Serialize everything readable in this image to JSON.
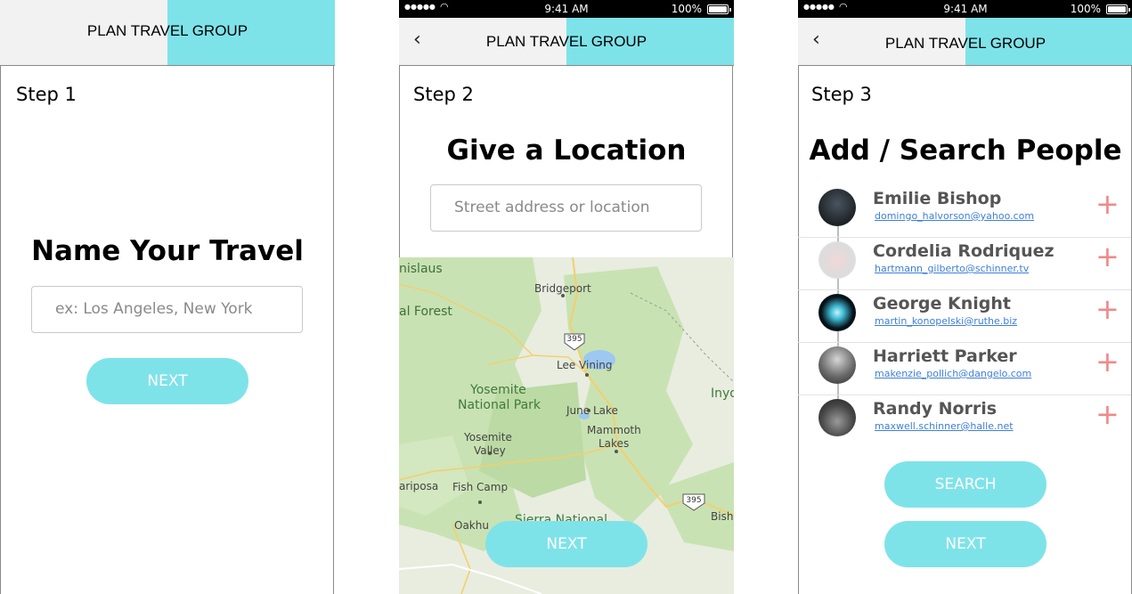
{
  "app_title": "PLAN TRAVEL GROUP",
  "status_bar": {
    "time": "9:41 AM",
    "battery": "100%"
  },
  "step1": {
    "step_label": "Step 1",
    "heading": "Name Your Travel",
    "input_placeholder": "ex: Los Angeles, New York",
    "next_label": "NEXT"
  },
  "step2": {
    "step_label": "Step 2",
    "heading": "Give a Location",
    "input_placeholder": "Street address or location",
    "next_label": "NEXT",
    "map_labels": {
      "stanislaus": "nislaus",
      "forest": "al Forest",
      "bridgeport": "Bridgeport",
      "hwy395_top": "395",
      "lee_vining": "Lee Vining",
      "yosemite_np_1": "Yosemite",
      "yosemite_np_2": "National Park",
      "inyo": "Inyo",
      "june_lake": "June Lake",
      "mammoth_1": "Mammoth",
      "mammoth_2": "Lakes",
      "yosemite_valley_1": "Yosemite",
      "yosemite_valley_2": "Valley",
      "mariposa": "ariposa",
      "fish_camp": "Fish Camp",
      "hwy395_bottom": "395",
      "bishop": "Bish",
      "oakhurst": "Oakhu",
      "sierra_national": "Sierra National"
    }
  },
  "step3": {
    "step_label": "Step 3",
    "heading": "Add / Search People",
    "people": [
      {
        "name": "Emilie Bishop",
        "email": "domingo_halvorson@yahoo.com"
      },
      {
        "name": "Cordelia Rodriquez",
        "email": "hartmann_gilberto@schinner.tv"
      },
      {
        "name": "George Knight",
        "email": "martin_konopelski@ruthe.biz"
      },
      {
        "name": "Harriett Parker",
        "email": "makenzie_pollich@dangelo.com"
      },
      {
        "name": "Randy Norris",
        "email": "maxwell.schinner@halle.net"
      }
    ],
    "add_symbol": "+",
    "search_label": "SEARCH",
    "next_label": "NEXT"
  },
  "colors": {
    "accent": "#7ee3e9",
    "add": "#ef8a8a",
    "link": "#3e7fd8",
    "header_bg": "#f2f2f2"
  }
}
